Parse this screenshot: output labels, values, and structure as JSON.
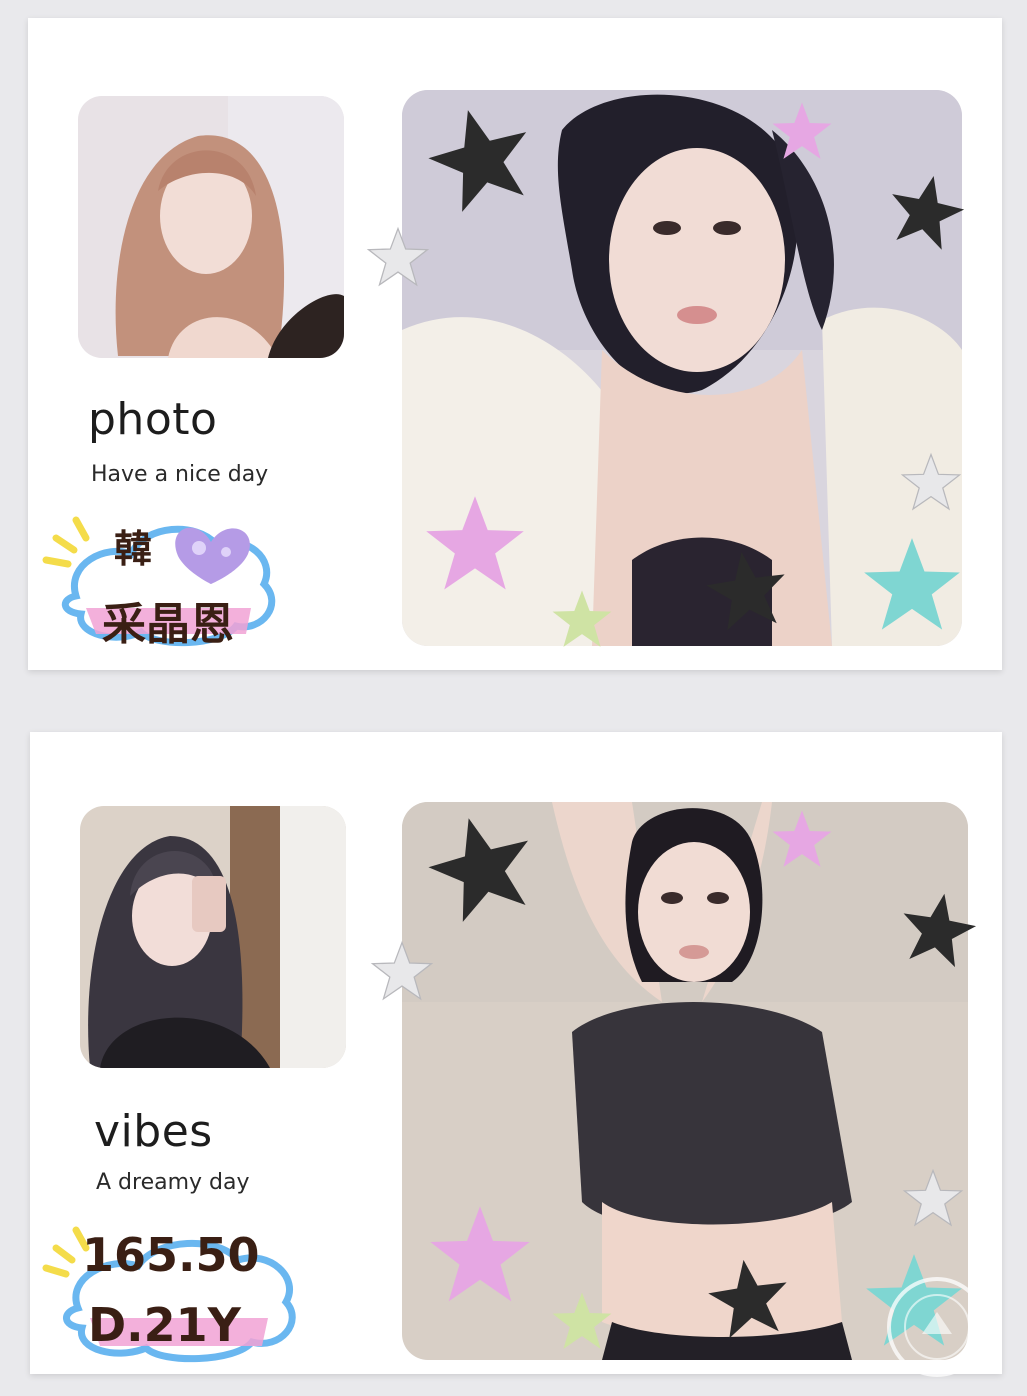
{
  "cards": [
    {
      "title": "photo",
      "subtitle": "Have a nice day",
      "sticker": {
        "line1": "韓",
        "line2": "采晶恩"
      }
    },
    {
      "title": "vibes",
      "subtitle": "A dreamy day",
      "sticker": {
        "line1": "165.50",
        "line2": "D.21Y"
      }
    }
  ],
  "colors": {
    "star_black": "#2b2b2b",
    "star_pink": "#e6a7e3",
    "star_silver": "#e8e8ea",
    "star_mint": "#7fd6d2",
    "star_lime": "#cfe3a4",
    "sticker_cloud_blue": "#6ab7f0",
    "sticker_pink_band": "#f1a2d5",
    "sticker_yellow_burst": "#f4dc4a",
    "heart_purple": "#b59be6"
  }
}
